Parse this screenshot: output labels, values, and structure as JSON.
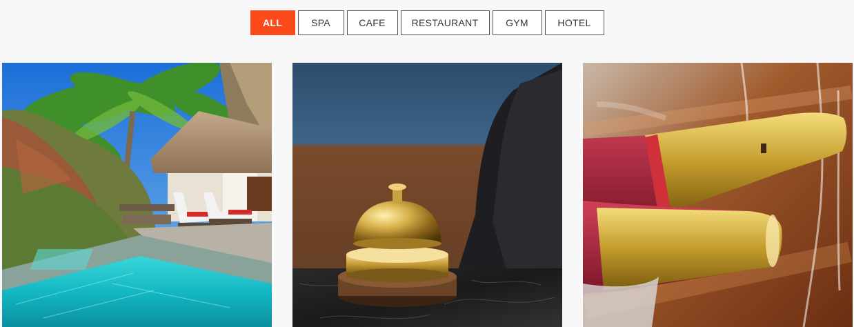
{
  "filters": {
    "items": [
      {
        "label": "ALL",
        "active": true
      },
      {
        "label": "SPA",
        "active": false
      },
      {
        "label": "CAFE",
        "active": false
      },
      {
        "label": "RESTAURANT",
        "active": false
      },
      {
        "label": "GYM",
        "active": false
      },
      {
        "label": "HOTEL",
        "active": false
      }
    ]
  },
  "colors": {
    "accent": "#fc4a1a",
    "page_background": "#f8f8f8",
    "button_border": "#555555"
  },
  "gallery": {
    "items": [
      {
        "subject": "tropical villa with turquoise pool"
      },
      {
        "subject": "brass reception desk bell"
      },
      {
        "subject": "champagne bottles on ice"
      }
    ]
  }
}
